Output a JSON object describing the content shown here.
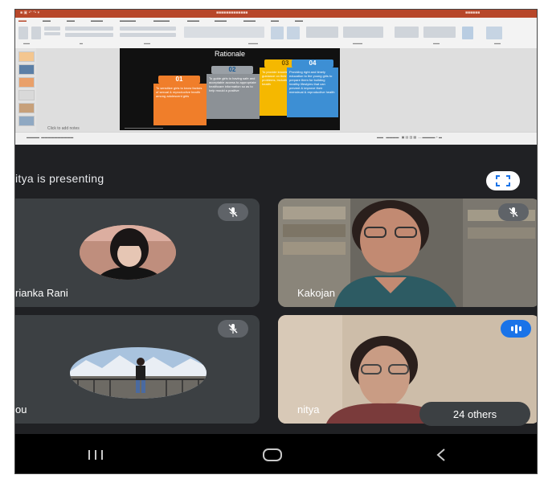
{
  "slide": {
    "title": "Rationale",
    "cards": [
      {
        "num": "01",
        "text": "To sensitize girls to know factors of sexual & reproductive health among adolescent girls"
      },
      {
        "num": "02",
        "text": "To guide girls to having safe and acceptable access to appropriate healthcare information so as to help mould a positive"
      },
      {
        "num": "03",
        "text": "To provide knowledge to girls and guidance on their health problems, including menstrual health"
      },
      {
        "num": "04",
        "text": "Providing right and timely education to the young girls to prepare them for building healthy lifestyles that can prevent & improve their menstrual & reproductive health"
      }
    ],
    "notes_placeholder": "Click to add notes"
  },
  "meeting": {
    "presenting_text": "itya is presenting",
    "others_label": "24 others"
  },
  "participants": [
    {
      "name": "rianka Rani"
    },
    {
      "name": "Kakojan"
    },
    {
      "name": "ou"
    },
    {
      "name": "nitya"
    }
  ],
  "colors": {
    "card1": "#f07e2a",
    "card2": "#9aa0a6",
    "card3": "#f5b800",
    "card4": "#3d8fd4",
    "speaking": "#1a73e8"
  }
}
